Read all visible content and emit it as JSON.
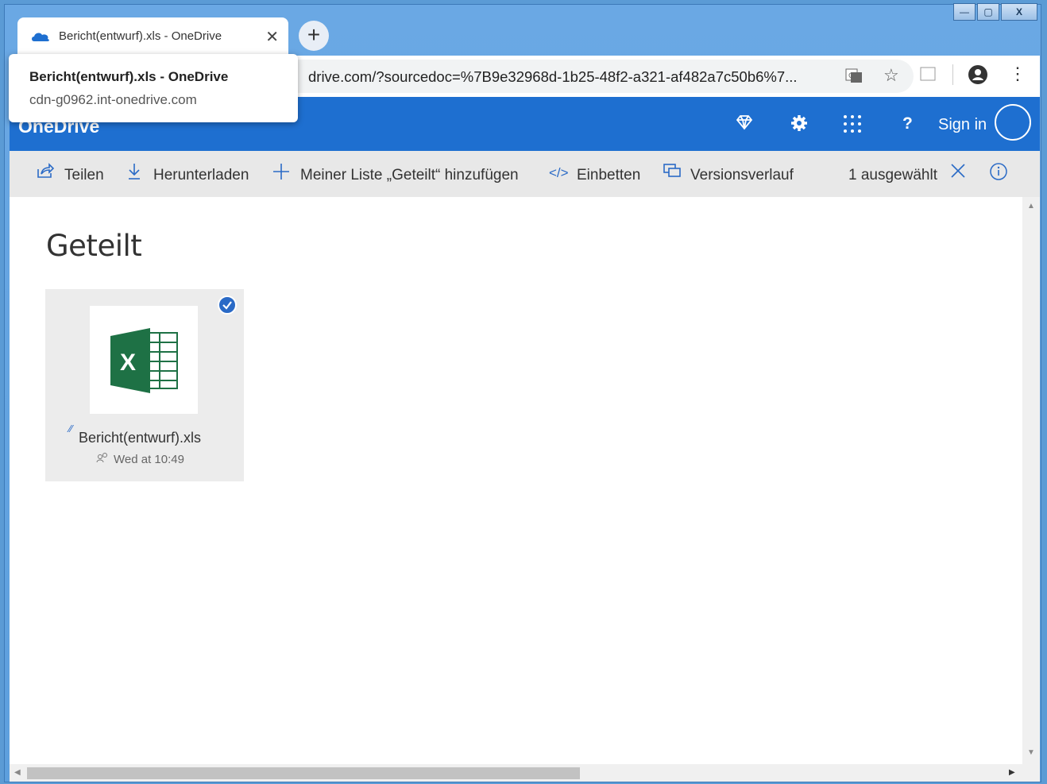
{
  "window": {
    "controls": {
      "minimize": "—",
      "maximize": "▢",
      "close": "X"
    }
  },
  "tab": {
    "title": "Bericht(entwurf).xls - OneDrive",
    "close_glyph": "✕",
    "new_tab_glyph": "+"
  },
  "tooltip": {
    "title": "Bericht(entwurf).xls - OneDrive",
    "host": "cdn-g0962.int-onedrive.com"
  },
  "address_bar": {
    "url": "drive.com/?sourcedoc=%7B9e32968d-1b25-48f2-a321-af482a7c50b6%7...",
    "icons": [
      "translate-icon",
      "star-icon",
      "extension-icon",
      "profile-icon",
      "menu-icon"
    ]
  },
  "header": {
    "brand": "OneDrive",
    "sign_in": "Sign in",
    "icons": [
      "diamond-icon",
      "gear-icon",
      "app-launcher-icon",
      "help-icon"
    ]
  },
  "commands": {
    "share": "Teilen",
    "download": "Herunterladen",
    "add_to_list": "Meiner Liste „Geteilt“ hinzufügen",
    "embed": "Einbetten",
    "version_history": "Versionsverlauf",
    "selected": "1 ausgewählt"
  },
  "main": {
    "title": "Geteilt",
    "files": [
      {
        "name": "Bericht(entwurf).xls",
        "modified": "Wed at 10:49",
        "selected": true,
        "icon": "excel-icon"
      }
    ]
  },
  "colors": {
    "header_blue": "#1e6fd0",
    "accent": "#2a6ac6",
    "excel_green": "#1e7145"
  }
}
